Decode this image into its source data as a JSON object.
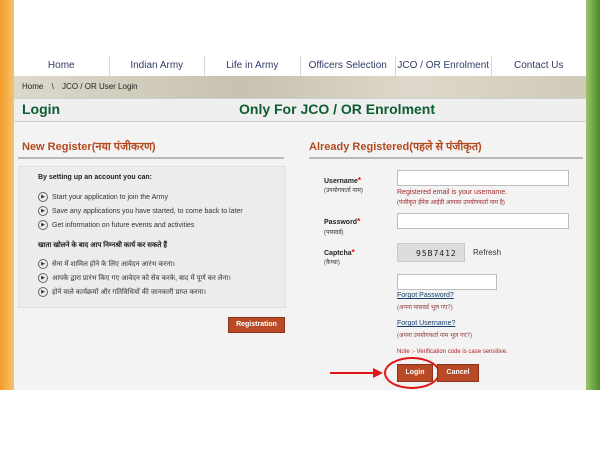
{
  "nav": [
    "Home",
    "Indian Army",
    "Life in Army",
    "Officers Selection",
    "JCO / OR Enrolment",
    "Contact Us"
  ],
  "breadcrumb": [
    "Home",
    "\\",
    "JCO / OR User Login"
  ],
  "titles": {
    "login": "Login",
    "center": "Only For JCO / OR Enrolment",
    "new_register": "New Register(नया पंजीकरण)",
    "already_registered": "Already Registered(पहले से पंजीकृत)"
  },
  "left_box": {
    "heading_en": "By setting up an account you can:",
    "items_en": [
      "Start your application to join the Army",
      "Save any applications you have started, to come back to later",
      "Get information on future events and activities"
    ],
    "heading_hi": "खाता खोलने के बाद आप निम्नश्री कार्य कर सकते हैं",
    "items_hi": [
      "सेना में शामिल होने के लिए आवेदन आरंभ करना।",
      "आपके द्वारा प्रारंभ किए गए आवेदन को सेव करके, बाद में पूर्ण कर लेना।",
      "होने वाले कार्यक्रमों और गतिविधियों की जानकारी प्राप्त करना।"
    ],
    "registration_button": "Registration"
  },
  "form": {
    "username_label": "Username",
    "username_hi": "(उपयोगकर्ता नाम)",
    "username_error_1": "Registered email is your username.",
    "username_error_2": "(पंजीकृत ईमेल आईडी आपका उपयोगकर्ता नाम है)",
    "password_label": "Password",
    "password_hi": "(पासवर्ड)",
    "captcha_label": "Captcha",
    "captcha_hi": "(कैप्चा)",
    "captcha_value": "95B7412",
    "refresh": "Refresh",
    "forgot_password": "Forgot Password?",
    "forgot_password_hi": "(अपना पासवर्ड भूल गए?)",
    "forgot_username": "Forgot Username?",
    "forgot_username_hi": "(अपना उपयोगकर्ता नाम भूल गए?)",
    "note": "Note :- Verification code is case sensitive.",
    "login_button": "Login",
    "cancel_button": "Cancel"
  }
}
